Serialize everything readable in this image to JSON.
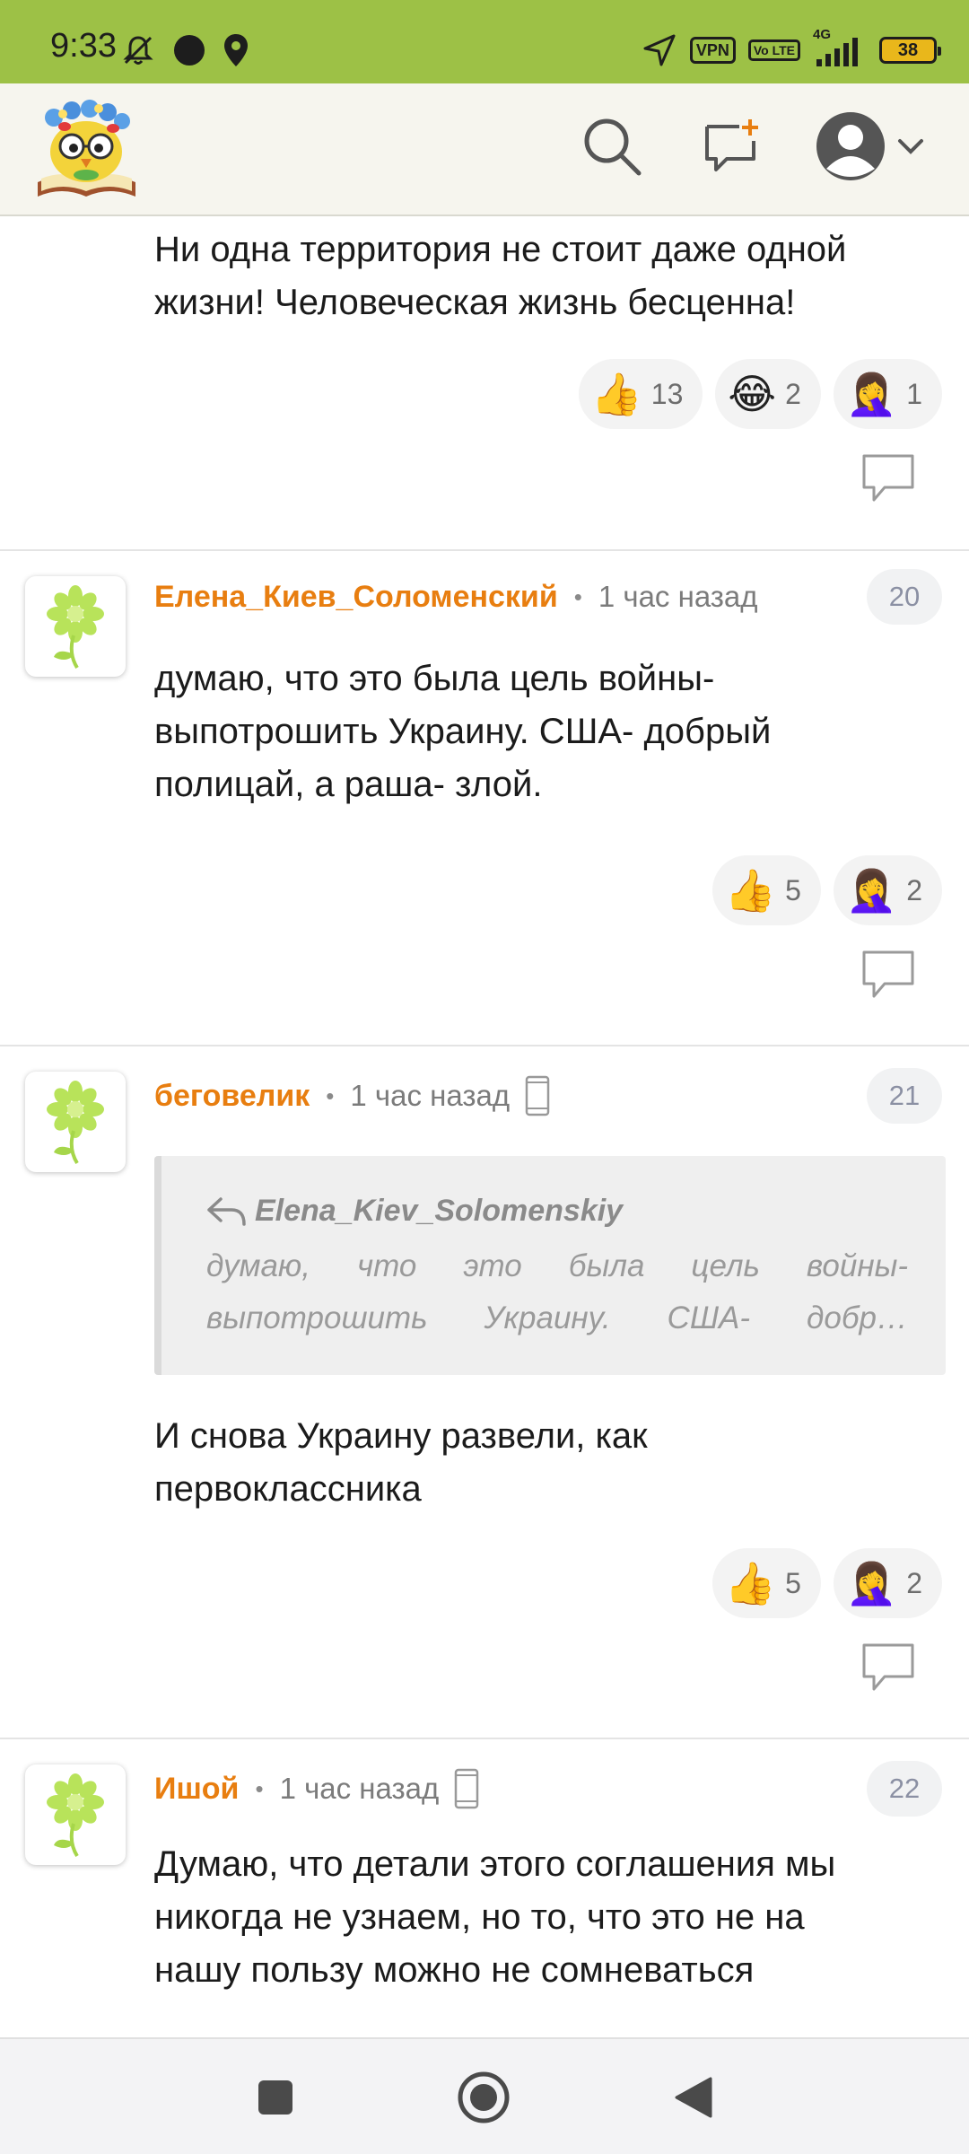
{
  "status_bar": {
    "time": "9:33",
    "vpn": "VPN",
    "volte": "Vo LTE",
    "network": "4G",
    "battery": "38"
  },
  "header": {
    "logo_icon": "owl-book-logo",
    "search_icon": "search-icon",
    "new_post_icon": "new-post-icon",
    "profile_icon": "profile-icon"
  },
  "comments": [
    {
      "text": "Ни одна территория не стоит даже одной жизни! Человеческая жизнь бесценна!",
      "reactions": [
        {
          "emoji": "👍",
          "count": "13"
        },
        {
          "emoji": "😂",
          "count": "2"
        },
        {
          "emoji": "🤦‍♀️",
          "count": "1"
        }
      ]
    },
    {
      "author": "Елена_Киев_Соломенский",
      "time": "1 час назад",
      "number": "20",
      "text_lines": [
        "думаю, что это была цель войны-",
        "выпотрошить Украину. США- добрый",
        "полицай, а раша- злой."
      ],
      "reactions": [
        {
          "emoji": "👍",
          "count": "5"
        },
        {
          "emoji": "🤦‍♀️",
          "count": "2"
        }
      ]
    },
    {
      "author": "беговелик",
      "time": "1 час назад",
      "number": "21",
      "quote": {
        "author": "Elena_Kiev_Solomenskiy",
        "line1": "думаю, что это была цель войны-",
        "line2": "выпотрошить Украину. США- добр…"
      },
      "text_lines": [
        "И снова Украину развели, как",
        "первоклассника"
      ],
      "reactions": [
        {
          "emoji": "👍",
          "count": "5"
        },
        {
          "emoji": "🤦‍♀️",
          "count": "2"
        }
      ]
    },
    {
      "author": "Ишой",
      "time": "1 час назад",
      "number": "22",
      "text_lines": [
        "Думаю, что детали этого соглашения мы",
        "никогда не узнаем, но то, что это не на",
        "нашу пользу можно не сомневаться"
      ]
    }
  ],
  "colors": {
    "status_bar": "#9dc146",
    "author": "#e87e10",
    "header_bg": "#f6f5ee"
  }
}
